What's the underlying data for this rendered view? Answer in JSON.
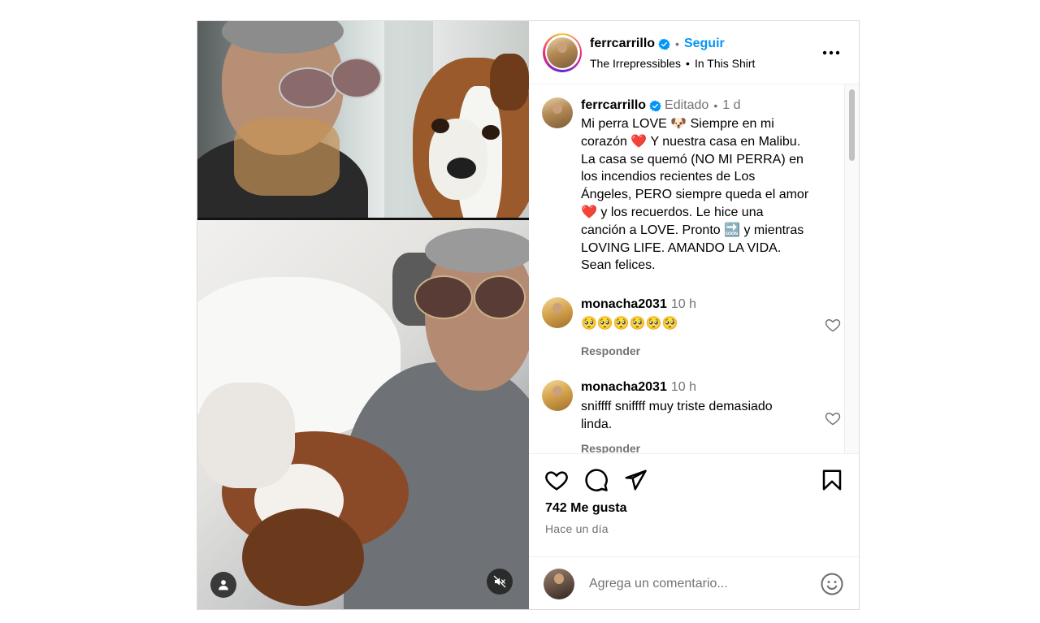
{
  "author": {
    "username": "ferrcarrillo",
    "follow_label": "Seguir",
    "dot": "•",
    "audio_artist": "The Irrepressibles",
    "audio_song": "In This Shirt"
  },
  "caption": {
    "username": "ferrcarrillo",
    "edited_label": "Editado",
    "dot": "•",
    "time": "1 d",
    "text": "Mi perra LOVE 🐶 Siempre en mi\ncorazón ❤️ Y nuestra casa en Malibu.\nLa casa se quemó (NO MI PERRA) en\nlos incendios recientes de Los\nÁngeles, PERO siempre queda el amor\n❤️ y los recuerdos. Le hice una\ncanción a LOVE. Pronto 🔜 y mientras\nLOVING LIFE. AMANDO LA VIDA.\nSean felices."
  },
  "comments": [
    {
      "username": "monacha2031",
      "time": "10 h",
      "text": "🥺🥺🥺🥺🥺🥺",
      "reply_label": "Responder"
    },
    {
      "username": "monacha2031",
      "time": "10 h",
      "text": "sniffff sniffff muy triste demasiado\nlinda.",
      "reply_label": "Responder"
    }
  ],
  "engagement": {
    "likes": "742 Me gusta",
    "posted": "Hace un día"
  },
  "add_comment": {
    "placeholder": "Agrega un comentario..."
  },
  "colors": {
    "accent": "#0095f6",
    "verified": "#0095f6",
    "muted_text": "#737373"
  },
  "icons": {
    "like": "heart-icon",
    "comment": "comment-bubble-icon",
    "share": "paper-plane-icon",
    "save": "bookmark-icon",
    "more": "ellipsis-icon",
    "emoji": "smiley-icon",
    "tagged": "person-icon",
    "audio": "muted-speaker-icon"
  }
}
